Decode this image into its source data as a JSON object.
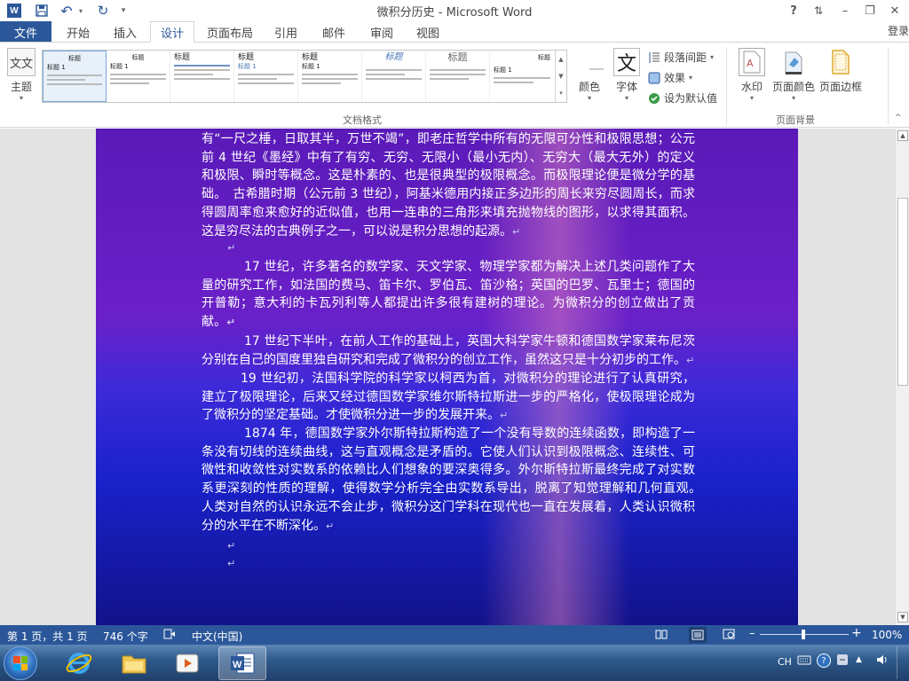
{
  "window": {
    "title": "微积分历史 - Microsoft Word",
    "help": "?",
    "minimize": "–",
    "restore": "❐",
    "close": "✕",
    "ribbon_display": "⇅"
  },
  "quick_access": {
    "app_icon": "W",
    "save": "💾",
    "undo": "↶",
    "redo": "↻",
    "customize": "▾"
  },
  "tabs": {
    "file": "文件",
    "items": [
      "开始",
      "插入",
      "设计",
      "页面布局",
      "引用",
      "邮件",
      "审阅",
      "视图"
    ],
    "active": "设计",
    "login": "登录"
  },
  "ribbon": {
    "theme_label": "主题",
    "theme_icon_text": "文文",
    "style_heading": "标题",
    "style_heading1": "标题 1",
    "group_doc_format": "文档格式",
    "colors_label": "颜色",
    "fonts_label": "字体",
    "fonts_icon_text": "文",
    "paragraph_spacing": "段落间距",
    "effects": "效果",
    "set_default": "设为默认值",
    "watermark": "水印",
    "page_color": "页面颜色",
    "page_borders": "页面边框",
    "group_page_background": "页面背景"
  },
  "document": {
    "p1": "有“一尺之棰，日取其半，万世不竭”，即老庄哲学中所有的无限可分性和极限思想；公元前 4 世纪《墨经》中有了有穷、无穷、无限小（最小无内）、无穷大（最大无外）的定义和极限、瞬时等概念。这是朴素的、也是很典型的极限概念。而极限理论便是微分学的基础。　古希腊时期（公元前 3 世纪），阿基米德用内接正多边形的周长来穷尽圆周长，而求得圆周率愈来愈好的近似值，也用一连串的三角形来填充抛物线的图形，以求得其面积。这是穷尽法的古典例子之一，可以说是积分思想的起源。",
    "p2": "17 世纪，许多著名的数学家、天文学家、物理学家都为解决上述几类问题作了大量的研究工作，如法国的费马、笛卡尔、罗伯瓦、笛沙格；英国的巴罗、瓦里士；德国的开普勒；意大利的卡瓦列利等人都提出许多很有建树的理论。为微积分的创立做出了贡献。",
    "p3": "17 世纪下半叶，在前人工作的基础上，英国大科学家牛顿和德国数学家莱布尼茨分别在自己的国度里独自研究和完成了微积分的创立工作，虽然这只是十分初步的工作。",
    "p4": "19 世纪初，法国科学院的科学家以柯西为首，对微积分的理论进行了认真研究，建立了极限理论，后来又经过德国数学家维尔斯特拉斯进一步的严格化，使极限理论成为了微积分的坚定基础。才使微积分进一步的发展开来。",
    "p5": "1874 年，德国数学家外尔斯特拉斯构造了一个没有导数的连续函数，即构造了一条没有切线的连续曲线，这与直观概念是矛盾的。它使人们认识到极限概念、连续性、可微性和收敛性对实数系的依赖比人们想象的要深奥得多。外尔斯特拉斯最终完成了对实数系更深刻的性质的理解，使得数学分析完全由实数系导出，脱离了知觉理解和几何直观。　人类对自然的认识永远不会止步，微积分这门学科在现代也一直在发展着，人类认识微积分的水平在不断深化。",
    "para_mark": "↵"
  },
  "status_bar": {
    "page": "第 1 页，共 1 页",
    "words": "746 个字",
    "language": "中文(中国)",
    "zoom": "100%",
    "zoom_level": 1.0
  },
  "taskbar": {
    "ime": "CH"
  }
}
